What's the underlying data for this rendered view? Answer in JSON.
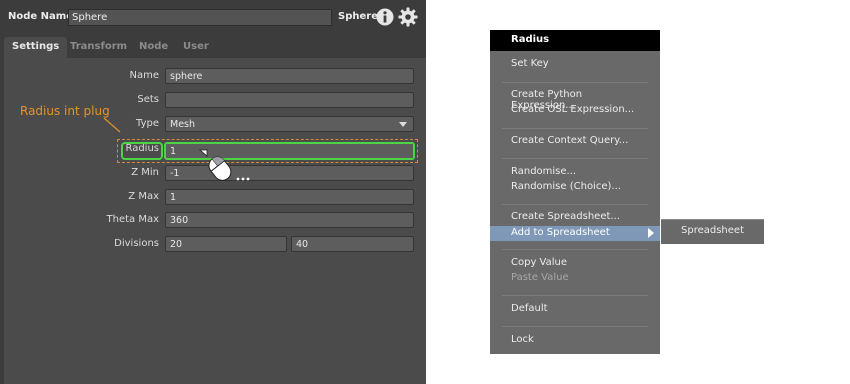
{
  "header": {
    "node_name_label": "Node Name",
    "node_name_value": "Sphere",
    "node_type": "Sphere"
  },
  "tabs": [
    {
      "label": "Settings",
      "active": true
    },
    {
      "label": "Transform",
      "active": false
    },
    {
      "label": "Node",
      "active": false
    },
    {
      "label": "User",
      "active": false
    }
  ],
  "plugs": {
    "name": {
      "label": "Name",
      "value": "sphere"
    },
    "sets": {
      "label": "Sets",
      "value": ""
    },
    "type": {
      "label": "Type",
      "value": "Mesh"
    },
    "radius": {
      "label": "Radius",
      "value": "1"
    },
    "zmin": {
      "label": "Z Min",
      "value": "-1"
    },
    "zmax": {
      "label": "Z Max",
      "value": "1"
    },
    "theta_max": {
      "label": "Theta Max",
      "value": "360"
    },
    "divisions": {
      "label": "Divisions",
      "value_a": "20",
      "value_b": "40"
    }
  },
  "annotation": {
    "text": "Radius int plug",
    "color": "#e5922e",
    "highlight_color": "#4cd444"
  },
  "context_menu": {
    "title": "Radius",
    "items": [
      {
        "label": "Set Key"
      },
      {
        "label": "Create Python Expression..."
      },
      {
        "label": "Create OSL Expression..."
      },
      {
        "label": "Create Context Query..."
      },
      {
        "label": "Randomise..."
      },
      {
        "label": "Randomise (Choice)..."
      },
      {
        "label": "Create Spreadsheet..."
      },
      {
        "label": "Add to Spreadsheet",
        "highlighted": true,
        "submenu": true
      },
      {
        "label": "Copy Value"
      },
      {
        "label": "Paste Value",
        "disabled": true
      },
      {
        "label": "Default"
      },
      {
        "label": "Lock"
      }
    ],
    "submenu_items": [
      {
        "label": "Spreadsheet"
      }
    ],
    "highlight_color": "#7f98b8"
  }
}
